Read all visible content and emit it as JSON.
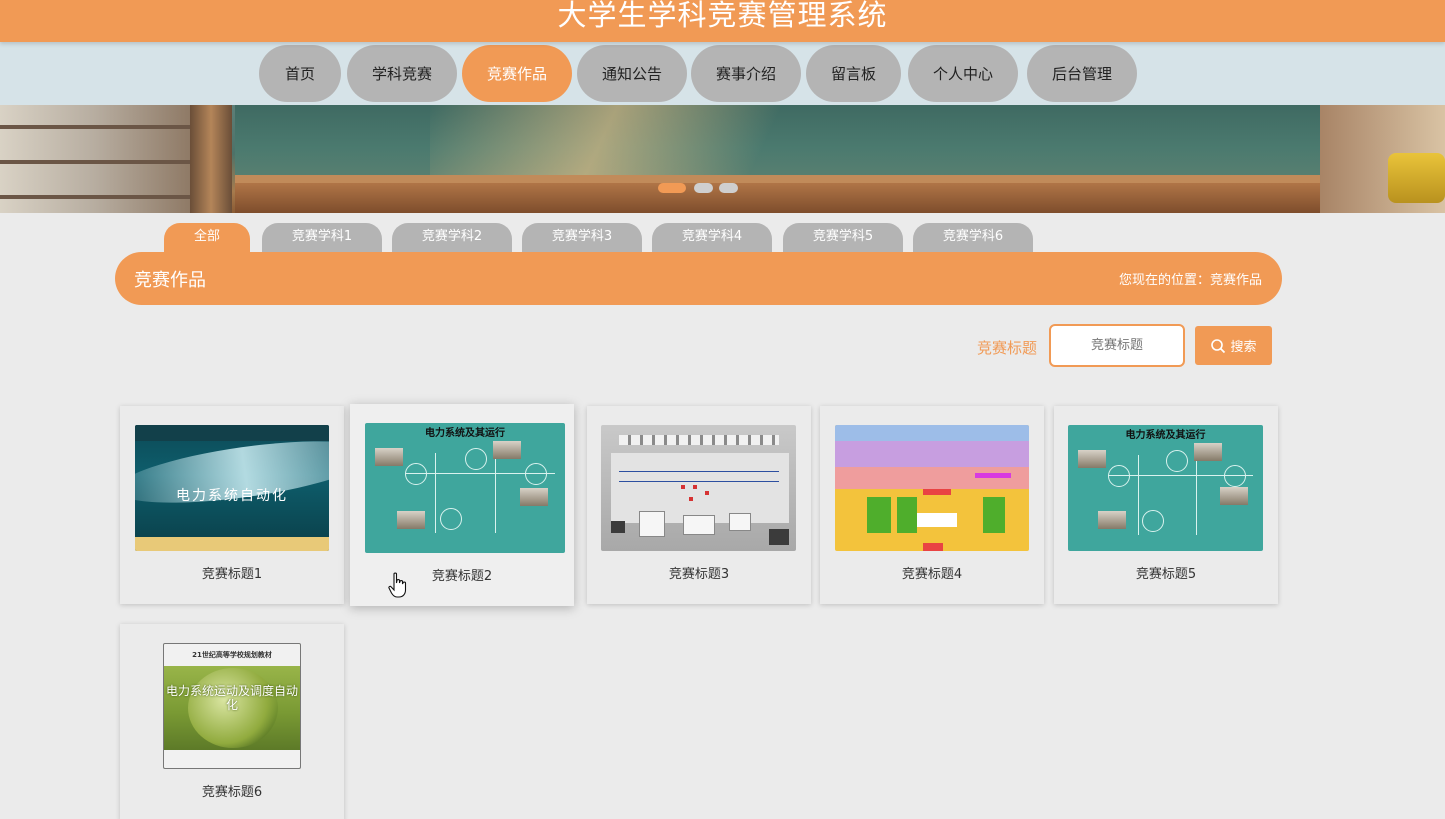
{
  "header": {
    "title": "大学生学科竞赛管理系统"
  },
  "nav": {
    "items": [
      {
        "label": "首页"
      },
      {
        "label": "学科竞赛"
      },
      {
        "label": "竞赛作品",
        "active": true
      },
      {
        "label": "通知公告"
      },
      {
        "label": "赛事介绍"
      },
      {
        "label": "留言板"
      },
      {
        "label": "个人中心"
      },
      {
        "label": "后台管理"
      }
    ]
  },
  "carousel": {
    "slide_count": 3,
    "active_index": 0
  },
  "categories": {
    "items": [
      {
        "label": "全部",
        "active": true
      },
      {
        "label": "竞赛学科1"
      },
      {
        "label": "竞赛学科2"
      },
      {
        "label": "竞赛学科3"
      },
      {
        "label": "竞赛学科4"
      },
      {
        "label": "竞赛学科5"
      },
      {
        "label": "竞赛学科6"
      }
    ]
  },
  "section": {
    "title": "竞赛作品",
    "breadcrumb": "您现在的位置：竞赛作品"
  },
  "search": {
    "label": "竞赛标题",
    "placeholder": "竞赛标题",
    "value": "",
    "button_label": "搜索"
  },
  "works": [
    {
      "title": "竞赛标题1",
      "cover_text": "电力系统自动化"
    },
    {
      "title": "竞赛标题2",
      "cover_text": "电力系统及其运行"
    },
    {
      "title": "竞赛标题3"
    },
    {
      "title": "竞赛标题4"
    },
    {
      "title": "竞赛标题5",
      "cover_text": "电力系统及其运行"
    },
    {
      "title": "竞赛标题6",
      "cover_text": "电力系统运动及调度自动化",
      "cover_header": "21世纪高等学校规划教材"
    }
  ],
  "colors": {
    "accent": "#f19a55",
    "inactive": "#b4b4b4",
    "nav_background": "#d6e3e8",
    "page_background": "#ebebeb"
  }
}
